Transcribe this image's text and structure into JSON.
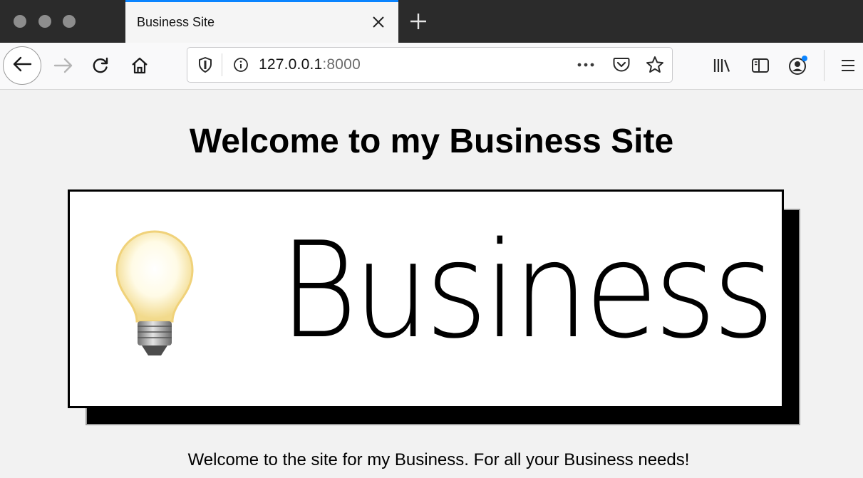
{
  "tab": {
    "title": "Business Site"
  },
  "url": {
    "host": "127.0.0.1",
    "port": ":8000"
  },
  "page": {
    "heading": "Welcome to my Business Site",
    "banner_text": "Business",
    "tagline": "Welcome to the site for my Business. For all your Business needs!"
  },
  "colors": {
    "accent": "#0a84ff",
    "notification_dot": "#0a84ff"
  },
  "icons": [
    "close-icon",
    "plus-icon",
    "back-arrow-icon",
    "forward-arrow-icon",
    "reload-icon",
    "home-icon",
    "shield-icon",
    "info-icon",
    "more-icon",
    "pocket-icon",
    "star-icon",
    "library-icon",
    "sidebar-icon",
    "account-icon",
    "menu-icon",
    "lightbulb-icon"
  ]
}
